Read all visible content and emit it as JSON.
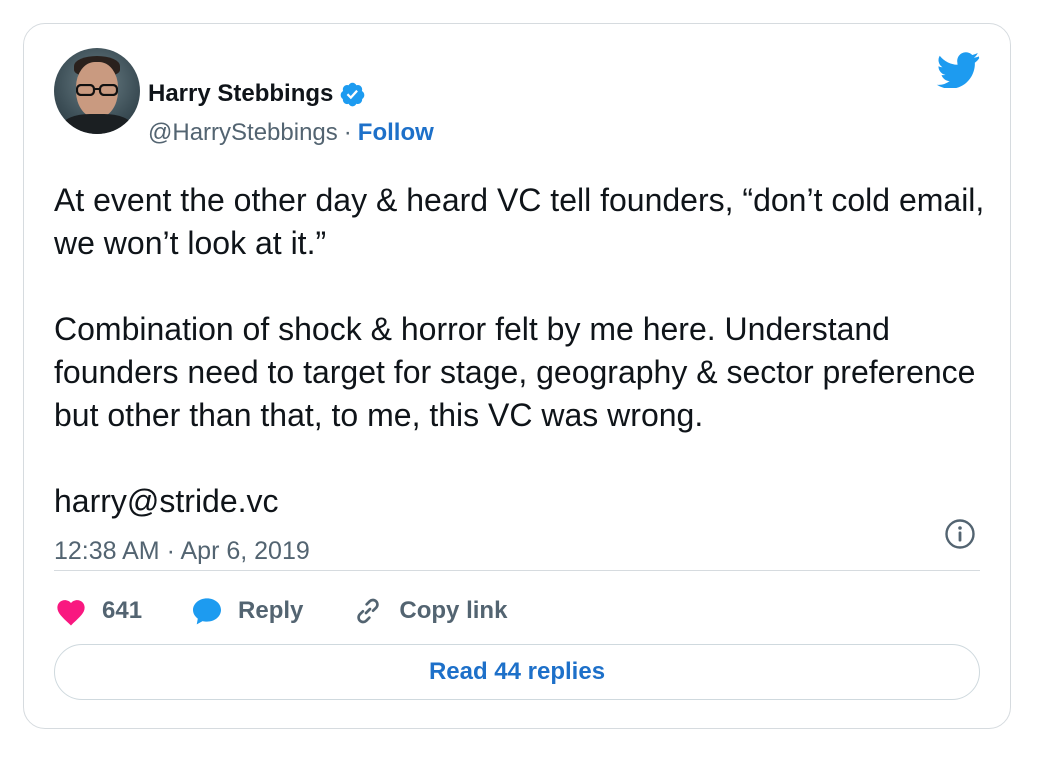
{
  "author": {
    "name": "Harry Stebbings",
    "handle": "@HarryStebbings",
    "separator": "·",
    "follow_label": "Follow"
  },
  "tweet": {
    "paragraphs": [
      "At event the other day & heard VC tell founders, “don’t cold email, we won’t look at it.”",
      "Combination of shock & horror felt by me here. Understand founders need to target for stage, geography & sector preference but other than that, to me, this VC was wrong.",
      "harry@stride.vc"
    ],
    "time": "12:38 AM",
    "date": "Apr 6, 2019",
    "meta_separator": "·"
  },
  "actions": {
    "like_count": "641",
    "reply_label": "Reply",
    "copy_link_label": "Copy link"
  },
  "footer": {
    "read_replies_label": "Read 44 replies"
  },
  "icons": {
    "verified": "verified-badge-icon",
    "brand": "twitter-bird-icon",
    "info": "info-icon",
    "like": "heart-icon",
    "reply": "speech-bubble-icon",
    "copy": "link-icon"
  },
  "colors": {
    "accent": "#1d9bf0",
    "link": "#1d70c9",
    "like": "#f91880",
    "muted": "#536471"
  }
}
